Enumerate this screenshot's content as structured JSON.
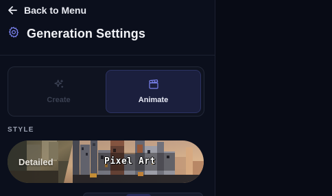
{
  "nav": {
    "back_label": "Back to Menu",
    "back_icon": "arrow-left-icon"
  },
  "header": {
    "title": "Generation Settings",
    "icon": "gear-icon"
  },
  "mode": {
    "options": [
      {
        "label": "Create",
        "icon": "sparkles-icon",
        "selected": false
      },
      {
        "label": "Animate",
        "icon": "clapperboard-icon",
        "selected": true
      }
    ]
  },
  "style": {
    "section_label": "STYLE",
    "options": [
      {
        "label": "Detailed",
        "selected": false
      },
      {
        "label": "Pixel Art",
        "selected": true
      }
    ]
  },
  "colors": {
    "accent": "#6b73e0",
    "selected_bg": "#1b1f3d",
    "sidebar_bg": "#0b0f1c"
  }
}
